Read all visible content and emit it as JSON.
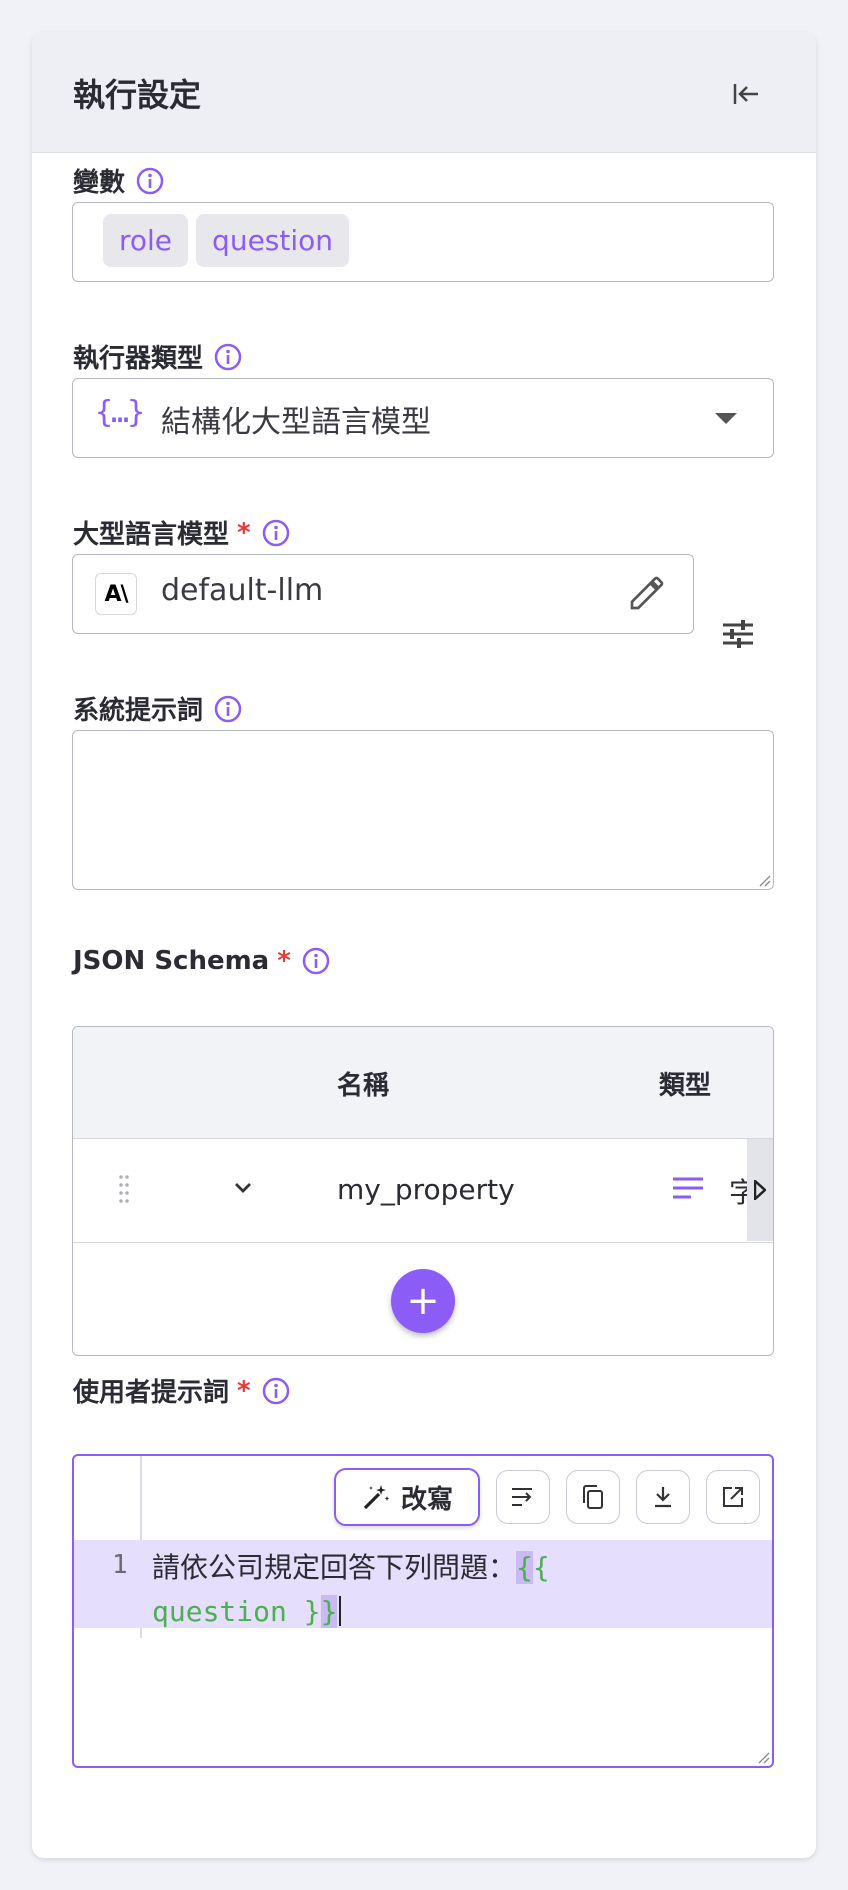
{
  "header": {
    "title": "執行設定"
  },
  "variables": {
    "label": "變數",
    "chips": [
      "role",
      "question"
    ]
  },
  "executor": {
    "label": "執行器類型",
    "icon": "{…}",
    "value": "結構化大型語言模型"
  },
  "llm": {
    "label": "大型語言模型",
    "required": "*",
    "logo": "A\\",
    "value": "default-llm"
  },
  "system_prompt": {
    "label": "系統提示詞",
    "value": ""
  },
  "schema": {
    "label": "JSON Schema",
    "required": "*",
    "columns": {
      "name": "名稱",
      "type": "類型"
    },
    "rows": [
      {
        "name": "my_property",
        "type": "字串"
      }
    ],
    "add_label": "+"
  },
  "user_prompt": {
    "label": "使用者提示詞",
    "required": "*",
    "rewrite_label": "改寫",
    "line_number": "1",
    "text_plain": "請依公司規定回答下列問題：",
    "tpl_open_1": "{",
    "tpl_open_2": "{",
    "tpl_var": "question }",
    "tpl_close": "}"
  },
  "colors": {
    "accent": "#8b5cf6",
    "required": "#e53935",
    "template": "#4caf50"
  }
}
